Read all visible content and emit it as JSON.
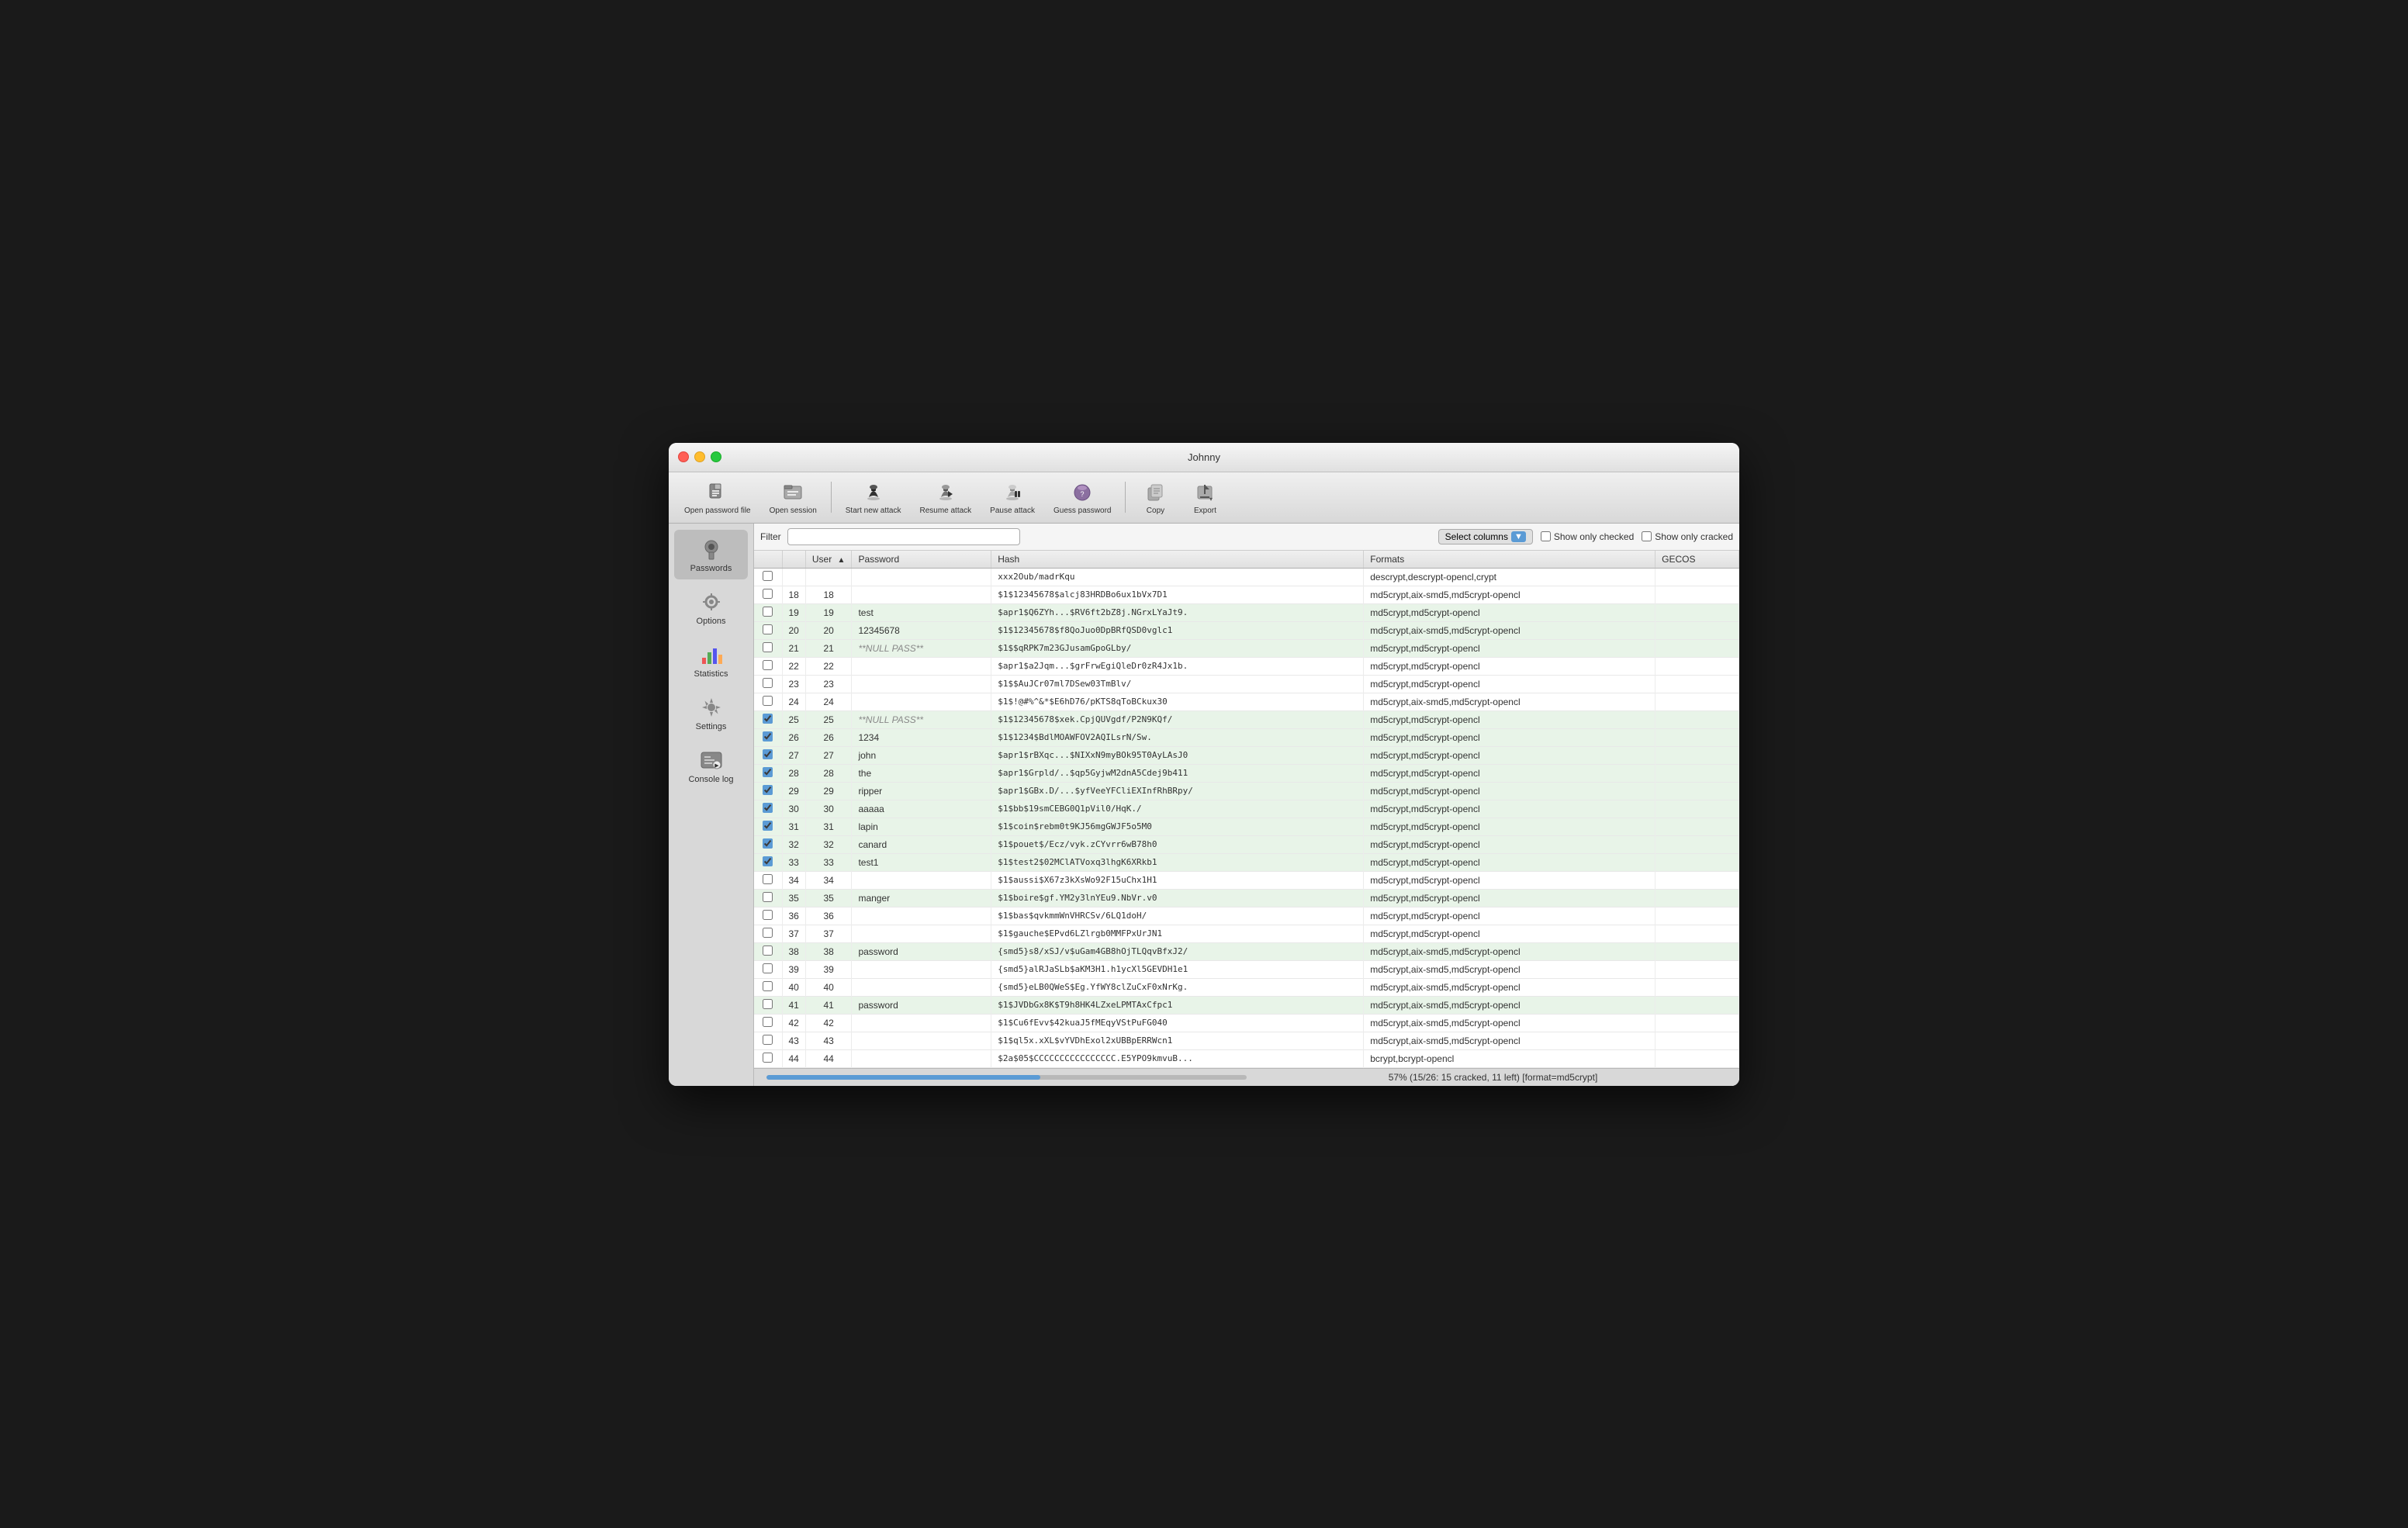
{
  "window": {
    "title": "Johnny"
  },
  "toolbar": {
    "buttons": [
      {
        "id": "open-password-file",
        "label": "Open password file",
        "icon": "📄"
      },
      {
        "id": "open-session",
        "label": "Open session",
        "icon": "📁"
      },
      {
        "id": "start-new-attack",
        "label": "Start new attack",
        "icon": "🎩"
      },
      {
        "id": "resume-attack",
        "label": "Resume attack",
        "icon": "▶️"
      },
      {
        "id": "pause-attack",
        "label": "Pause attack",
        "icon": "⏸"
      },
      {
        "id": "guess-password",
        "label": "Guess password",
        "icon": "🔮"
      },
      {
        "id": "copy",
        "label": "Copy",
        "icon": "💾"
      },
      {
        "id": "export",
        "label": "Export",
        "icon": "📤"
      }
    ]
  },
  "sidebar": {
    "items": [
      {
        "id": "passwords",
        "label": "Passwords",
        "icon": "🔑",
        "active": true
      },
      {
        "id": "options",
        "label": "Options",
        "icon": "⚙️"
      },
      {
        "id": "statistics",
        "label": "Statistics",
        "icon": "📊"
      },
      {
        "id": "settings",
        "label": "Settings",
        "icon": "🔧"
      },
      {
        "id": "console-log",
        "label": "Console log",
        "icon": "🖥"
      }
    ]
  },
  "filter_bar": {
    "filter_label": "Filter",
    "filter_placeholder": "",
    "select_columns_label": "Select columns",
    "show_only_checked_label": "Show only checked",
    "show_only_cracked_label": "Show only cracked"
  },
  "table": {
    "columns": [
      {
        "id": "checkbox",
        "label": ""
      },
      {
        "id": "row-num",
        "label": ""
      },
      {
        "id": "user",
        "label": "User",
        "sortable": true,
        "sort_dir": "asc"
      },
      {
        "id": "password",
        "label": "Password"
      },
      {
        "id": "hash",
        "label": "Hash"
      },
      {
        "id": "formats",
        "label": "Formats"
      },
      {
        "id": "gecos",
        "label": "GECOS"
      }
    ],
    "rows": [
      {
        "row_num": "",
        "checked": false,
        "user": "",
        "password": "",
        "hash": "xxx2Oub/madrKqu",
        "formats": "descrypt,descrypt-opencl,crypt",
        "gecos": "",
        "cracked": false
      },
      {
        "row_num": "18",
        "checked": false,
        "user": "18",
        "password": "",
        "hash": "$1$12345678$alcj83HRDBo6ux1bVx7D1",
        "formats": "md5crypt,aix-smd5,md5crypt-opencl",
        "gecos": "",
        "cracked": false
      },
      {
        "row_num": "19",
        "checked": false,
        "user": "19",
        "password": "test",
        "hash": "$apr1$Q6ZYh...$RV6ft2bZ8j.NGrxLYaJt9.",
        "formats": "md5crypt,md5crypt-opencl",
        "gecos": "",
        "cracked": true
      },
      {
        "row_num": "20",
        "checked": false,
        "user": "20",
        "password": "12345678",
        "hash": "$1$12345678$f8QoJuo0DpBRfQSD0vglc1",
        "formats": "md5crypt,aix-smd5,md5crypt-opencl",
        "gecos": "",
        "cracked": true
      },
      {
        "row_num": "21",
        "checked": false,
        "user": "21",
        "password": "**NULL PASS**",
        "hash": "$1$$qRPK7m23GJusamGpoGLby/",
        "formats": "md5crypt,md5crypt-opencl",
        "gecos": "",
        "cracked": true,
        "null_pass": true
      },
      {
        "row_num": "22",
        "checked": false,
        "user": "22",
        "password": "",
        "hash": "$apr1$a2Jqm...$grFrwEgiQleDr0zR4Jx1b.",
        "formats": "md5crypt,md5crypt-opencl",
        "gecos": "",
        "cracked": false
      },
      {
        "row_num": "23",
        "checked": false,
        "user": "23",
        "password": "",
        "hash": "$1$$AuJCr07ml7DSew03TmBlv/",
        "formats": "md5crypt,md5crypt-opencl",
        "gecos": "",
        "cracked": false
      },
      {
        "row_num": "24",
        "checked": false,
        "user": "24",
        "password": "",
        "hash": "$1$!@#%^&*$E6hD76/pKTS8qToBCkux30",
        "formats": "md5crypt,aix-smd5,md5crypt-opencl",
        "gecos": "",
        "cracked": false
      },
      {
        "row_num": "25",
        "checked": true,
        "user": "25",
        "password": "**NULL PASS**",
        "hash": "$1$12345678$xek.CpjQUVgdf/P2N9KQf/",
        "formats": "md5crypt,md5crypt-opencl",
        "gecos": "",
        "cracked": true,
        "null_pass": true
      },
      {
        "row_num": "26",
        "checked": true,
        "user": "26",
        "password": "1234",
        "hash": "$1$1234$BdlMOAWFOV2AQILsrN/Sw.",
        "formats": "md5crypt,md5crypt-opencl",
        "gecos": "",
        "cracked": true
      },
      {
        "row_num": "27",
        "checked": true,
        "user": "27",
        "password": "john",
        "hash": "$apr1$rBXqc...$NIXxN9myBOk95T0AyLAsJ0",
        "formats": "md5crypt,md5crypt-opencl",
        "gecos": "",
        "cracked": true
      },
      {
        "row_num": "28",
        "checked": true,
        "user": "28",
        "password": "the",
        "hash": "$apr1$Grpld/..$qp5GyjwM2dnA5Cdej9b411",
        "formats": "md5crypt,md5crypt-opencl",
        "gecos": "",
        "cracked": true
      },
      {
        "row_num": "29",
        "checked": true,
        "user": "29",
        "password": "ripper",
        "hash": "$apr1$GBx.D/...$yfVeeYFCliEXInfRhBRpy/",
        "formats": "md5crypt,md5crypt-opencl",
        "gecos": "",
        "cracked": true
      },
      {
        "row_num": "30",
        "checked": true,
        "user": "30",
        "password": "aaaaa",
        "hash": "$1$bb$19smCEBG0Q1pVil0/HqK./",
        "formats": "md5crypt,md5crypt-opencl",
        "gecos": "",
        "cracked": true
      },
      {
        "row_num": "31",
        "checked": true,
        "user": "31",
        "password": "lapin",
        "hash": "$1$coin$rebm0t9KJ56mgGWJF5o5M0",
        "formats": "md5crypt,md5crypt-opencl",
        "gecos": "",
        "cracked": true
      },
      {
        "row_num": "32",
        "checked": true,
        "user": "32",
        "password": "canard",
        "hash": "$1$pouet$/Ecz/vyk.zCYvrr6wB78h0",
        "formats": "md5crypt,md5crypt-opencl",
        "gecos": "",
        "cracked": true
      },
      {
        "row_num": "33",
        "checked": true,
        "user": "33",
        "password": "test1",
        "hash": "$1$test2$02MClATVoxq3lhgK6XRkb1",
        "formats": "md5crypt,md5crypt-opencl",
        "gecos": "",
        "cracked": true
      },
      {
        "row_num": "34",
        "checked": false,
        "user": "34",
        "password": "",
        "hash": "$1$aussi$X67z3kXsWo92F15uChx1H1",
        "formats": "md5crypt,md5crypt-opencl",
        "gecos": "",
        "cracked": false
      },
      {
        "row_num": "35",
        "checked": false,
        "user": "35",
        "password": "manger",
        "hash": "$1$boire$gf.YM2y3lnYEu9.NbVr.v0",
        "formats": "md5crypt,md5crypt-opencl",
        "gecos": "",
        "cracked": true
      },
      {
        "row_num": "36",
        "checked": false,
        "user": "36",
        "password": "",
        "hash": "$1$bas$qvkmmWnVHRCSv/6LQ1doH/",
        "formats": "md5crypt,md5crypt-opencl",
        "gecos": "",
        "cracked": false
      },
      {
        "row_num": "37",
        "checked": false,
        "user": "37",
        "password": "",
        "hash": "$1$gauche$EPvd6LZlrgb0MMFPxUrJN1",
        "formats": "md5crypt,md5crypt-opencl",
        "gecos": "",
        "cracked": false
      },
      {
        "row_num": "38",
        "checked": false,
        "user": "38",
        "password": "password",
        "hash": "{smd5}s8/xSJ/v$uGam4GB8hOjTLQqvBfxJ2/",
        "formats": "md5crypt,aix-smd5,md5crypt-opencl",
        "gecos": "",
        "cracked": true
      },
      {
        "row_num": "39",
        "checked": false,
        "user": "39",
        "password": "",
        "hash": "{smd5}alRJaSLb$aKM3H1.h1ycXl5GEVDH1e1",
        "formats": "md5crypt,aix-smd5,md5crypt-opencl",
        "gecos": "",
        "cracked": false
      },
      {
        "row_num": "40",
        "checked": false,
        "user": "40",
        "password": "",
        "hash": "{smd5}eLB0QWeS$Eg.YfWY8clZuCxF0xNrKg.",
        "formats": "md5crypt,aix-smd5,md5crypt-opencl",
        "gecos": "",
        "cracked": false
      },
      {
        "row_num": "41",
        "checked": false,
        "user": "41",
        "password": "password",
        "hash": "$1$JVDbGx8K$T9h8HK4LZxeLPMTAxCfpc1",
        "formats": "md5crypt,aix-smd5,md5crypt-opencl",
        "gecos": "",
        "cracked": true
      },
      {
        "row_num": "42",
        "checked": false,
        "user": "42",
        "password": "",
        "hash": "$1$Cu6fEvv$42kuaJ5fMEqyVStPuFG040",
        "formats": "md5crypt,aix-smd5,md5crypt-opencl",
        "gecos": "",
        "cracked": false
      },
      {
        "row_num": "43",
        "checked": false,
        "user": "43",
        "password": "",
        "hash": "$1$ql5x.xXL$vYVDhExol2xUBBpERRWcn1",
        "formats": "md5crypt,aix-smd5,md5crypt-opencl",
        "gecos": "",
        "cracked": false
      },
      {
        "row_num": "44",
        "checked": false,
        "user": "44",
        "password": "",
        "hash": "$2a$05$CCCCCCCCCCCCCCCC.E5YPO9kmvuB...",
        "formats": "bcrypt,bcrypt-opencl",
        "gecos": "",
        "cracked": false
      }
    ]
  },
  "status": {
    "text": "57% (15/26: 15 cracked, 11 left) [format=md5crypt]",
    "progress_pct": 57
  }
}
